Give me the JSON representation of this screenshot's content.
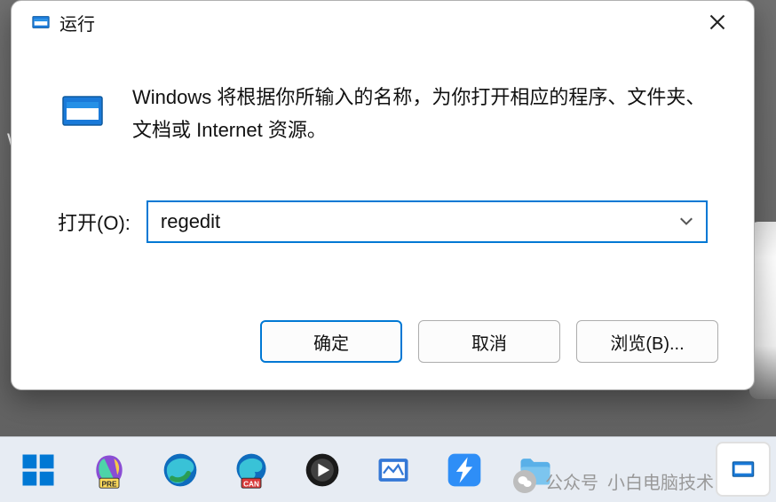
{
  "desktop_letter": "W",
  "dialog": {
    "title": "运行",
    "description": "Windows 将根据你所输入的名称，为你打开相应的程序、文件夹、文档或 Internet 资源。",
    "open_label": "打开(O):",
    "input_value": "regedit",
    "buttons": {
      "ok": "确定",
      "cancel": "取消",
      "browse": "浏览(B)..."
    }
  },
  "watermark": {
    "prefix": "公众号",
    "name": "小白电脑技术"
  },
  "colors": {
    "accent": "#0078d4",
    "taskbar": "#e7ecf3"
  },
  "taskbar_icons": [
    "start",
    "copilot-pre",
    "edge",
    "edge-can",
    "media-player",
    "monitor-tool",
    "xunlei",
    "folder"
  ]
}
